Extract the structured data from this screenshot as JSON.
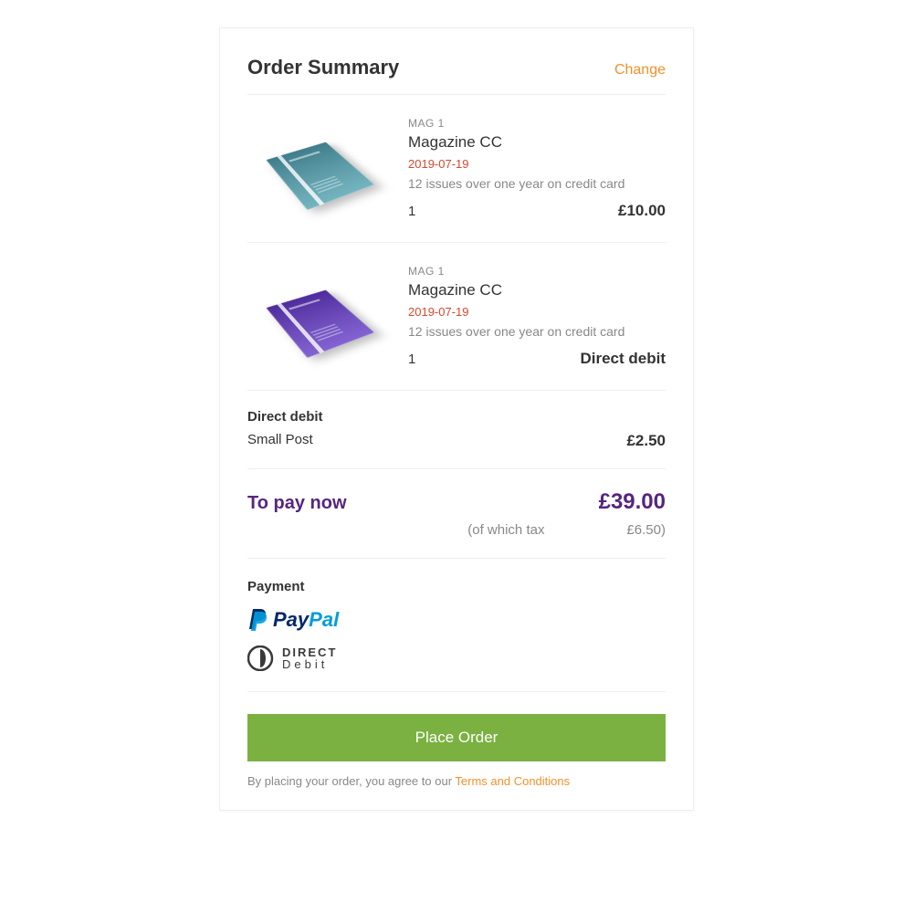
{
  "header": {
    "title": "Order Summary",
    "change_label": "Change"
  },
  "items": [
    {
      "sku": "MAG 1",
      "name": "Magazine CC",
      "date": "2019-07-19",
      "desc": "12 issues over one year on credit card",
      "qty": "1",
      "price": "£10.00",
      "color": "teal"
    },
    {
      "sku": "MAG 1",
      "name": "Magazine CC",
      "date": "2019-07-19",
      "desc": "12 issues over one year on credit card",
      "qty": "1",
      "price": "Direct debit",
      "color": "purple"
    }
  ],
  "shipping": {
    "title": "Direct debit",
    "label": "Small Post",
    "price": "£2.50"
  },
  "total": {
    "label": "To pay now",
    "price": "£39.00",
    "tax_label": "(of which tax",
    "tax_value": "£6.50)"
  },
  "payment": {
    "title": "Payment",
    "methods": [
      "PayPal",
      "Direct Debit"
    ]
  },
  "action": {
    "button_label": "Place Order",
    "terms_prefix": "By placing your order, you agree to our ",
    "terms_link": "Terms and Conditions"
  }
}
